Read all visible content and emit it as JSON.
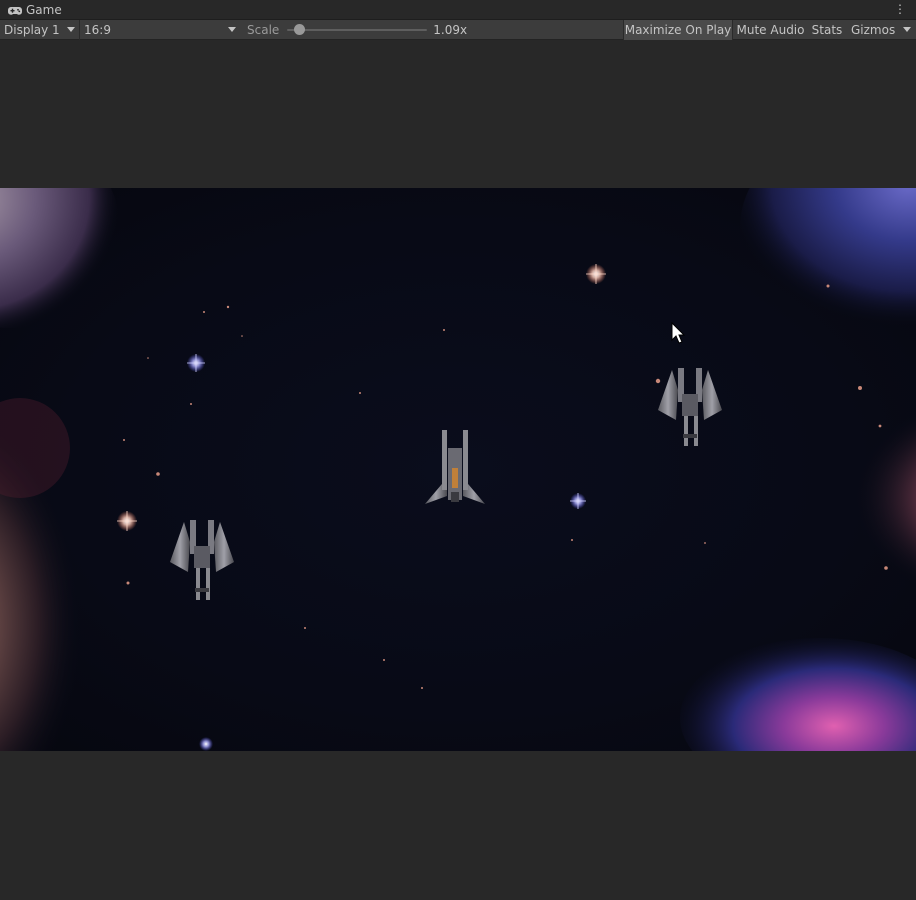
{
  "window": {
    "title": "Game"
  },
  "toolbar": {
    "display": "Display 1",
    "aspect": "16:9",
    "scale_label": "Scale",
    "scale_value": "1.09x",
    "scale_fraction": 0.05,
    "maximize_label": "Maximize On Play",
    "mute_label": "Mute Audio",
    "stats_label": "Stats",
    "gizmos_label": "Gizmos",
    "maximize_active": true
  },
  "game": {
    "background_color": "#080a16",
    "entities": [
      "player-ship",
      "enemy-ship",
      "enemy-ship",
      "mouse-cursor"
    ]
  },
  "icons": {
    "window": "gamepad-icon",
    "menu": "more-vertical-icon"
  }
}
